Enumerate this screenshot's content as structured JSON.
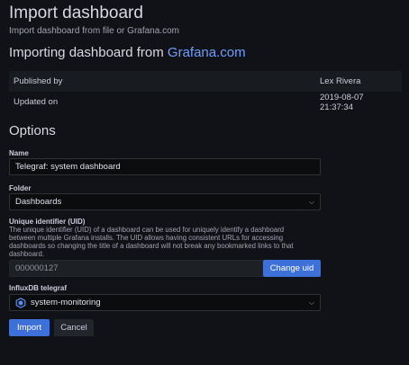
{
  "header": {
    "title": "Import dashboard",
    "subtitle": "Import dashboard from file or Grafana.com"
  },
  "importing": {
    "prefix": "Importing dashboard from ",
    "link": "Grafana.com"
  },
  "info": {
    "rows": [
      {
        "key": "Published by",
        "value": "Lex Rivera"
      },
      {
        "key": "Updated on",
        "value": "2019-08-07 21:37:34"
      }
    ]
  },
  "options": {
    "heading": "Options",
    "name_label": "Name",
    "name_value": "Telegraf: system dashboard",
    "folder_label": "Folder",
    "folder_value": "Dashboards",
    "uid_label": "Unique identifier (UID)",
    "uid_description": "The unique identifier (UID) of a dashboard can be used for uniquely identify a dashboard between multiple Grafana installs. The UID allows having consistent URLs for accessing dashboards so changing the title of a dashboard will not break any bookmarked links to that dashboard.",
    "uid_value": "000000127",
    "change_uid_label": "Change uid",
    "datasource_label": "InfluxDB telegraf",
    "datasource_value": "system-monitoring"
  },
  "actions": {
    "import_label": "Import",
    "cancel_label": "Cancel"
  },
  "colors": {
    "background": "#111217",
    "primary": "#3d71d9",
    "link": "#6e9fff"
  }
}
